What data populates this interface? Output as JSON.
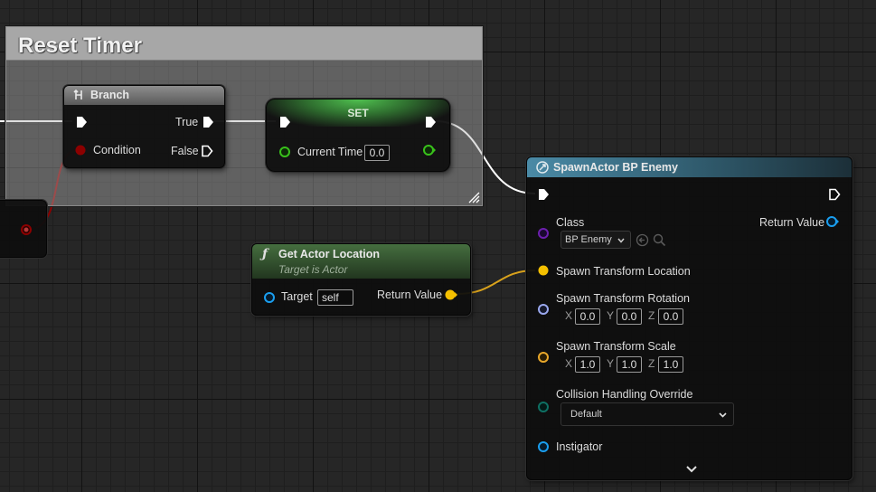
{
  "comment": {
    "title": "Reset Timer"
  },
  "branch": {
    "title": "Branch",
    "pins": {
      "true_label": "True",
      "false_label": "False",
      "condition_label": "Condition"
    }
  },
  "set_node": {
    "title": "SET",
    "variable_label": "Current Time",
    "variable_value": "0.0"
  },
  "get_actor_location": {
    "title": "Get Actor Location",
    "subtitle": "Target is Actor",
    "target_label": "Target",
    "target_value": "self",
    "return_label": "Return Value"
  },
  "spawn_actor": {
    "title": "SpawnActor BP Enemy",
    "class_label": "Class",
    "class_value": "BP Enemy",
    "return_label": "Return Value",
    "location_label": "Spawn Transform Location",
    "rotation_label": "Spawn Transform Rotation",
    "rotation": {
      "x_label": "X",
      "x": "0.0",
      "y_label": "Y",
      "y": "0.0",
      "z_label": "Z",
      "z": "0.0"
    },
    "scale_label": "Spawn Transform Scale",
    "scale": {
      "x_label": "X",
      "x": "1.0",
      "y_label": "Y",
      "y": "1.0",
      "z_label": "Z",
      "z": "1.0"
    },
    "collision_label": "Collision Handling Override",
    "collision_value": "Default",
    "instigator_label": "Instigator"
  },
  "colors": {
    "exec_wire": "#ffffff",
    "bool_pin": "#8c0000",
    "float_pin": "#39c11b",
    "vector_pin": "#f5c000",
    "object_pin": "#1a9eef",
    "class_pin": "#6c1fae",
    "rotator_pin": "#9aa8ee",
    "transform_pin": "#e8a72a",
    "enum_pin": "#0e7063",
    "spawn_header": "#3c6b80",
    "pure_header": "#3e6b3a",
    "set_header": "#3a8a3a"
  }
}
